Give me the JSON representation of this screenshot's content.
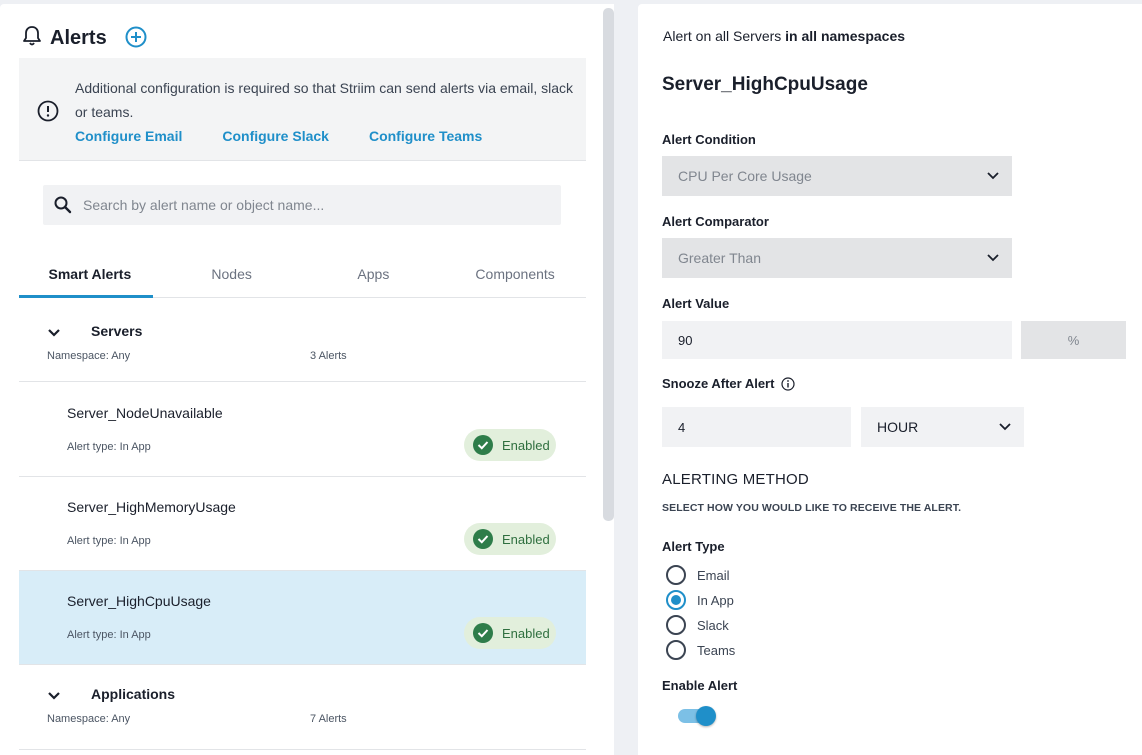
{
  "header": {
    "title": "Alerts"
  },
  "banner": {
    "message": "Additional configuration is required so that Striim can send alerts via email, slack or teams.",
    "links": [
      "Configure Email",
      "Configure Slack",
      "Configure Teams"
    ]
  },
  "search": {
    "placeholder": "Search by alert name or object name..."
  },
  "tabs": [
    "Smart Alerts",
    "Nodes",
    "Apps",
    "Components"
  ],
  "groups": [
    {
      "name": "Servers",
      "namespace": "Namespace: Any",
      "count": "3 Alerts"
    },
    {
      "name": "Applications",
      "namespace": "Namespace: Any",
      "count": "7 Alerts"
    }
  ],
  "alerts": [
    {
      "name": "Server_NodeUnavailable",
      "type": "Alert type: In App",
      "status": "Enabled"
    },
    {
      "name": "Server_HighMemoryUsage",
      "type": "Alert type: In App",
      "status": "Enabled"
    },
    {
      "name": "Server_HighCpuUsage",
      "type": "Alert type: In App",
      "status": "Enabled"
    }
  ],
  "detail": {
    "title_prefix": "Alert on all Servers",
    "title_suffix": "in all namespaces",
    "name": "Server_HighCpuUsage",
    "condition_label": "Alert Condition",
    "condition_value": "CPU Per Core Usage",
    "comparator_label": "Alert Comparator",
    "comparator_value": "Greater Than",
    "value_label": "Alert Value",
    "value": "90",
    "value_unit": "%",
    "snooze_label": "Snooze After Alert",
    "snooze_value": "4",
    "snooze_unit": "HOUR",
    "method_heading": "ALERTING METHOD",
    "method_sub": "SELECT HOW YOU WOULD LIKE TO RECEIVE THE ALERT.",
    "type_label": "Alert Type",
    "types": [
      "Email",
      "In App",
      "Slack",
      "Teams"
    ],
    "selected_type": "In App",
    "enable_label": "Enable Alert",
    "enabled": true
  },
  "colors": {
    "accent": "#1f8fc9",
    "selected_row": "#d8edf8",
    "badge_bg": "#e2efdc",
    "badge_check": "#2e8b57"
  }
}
